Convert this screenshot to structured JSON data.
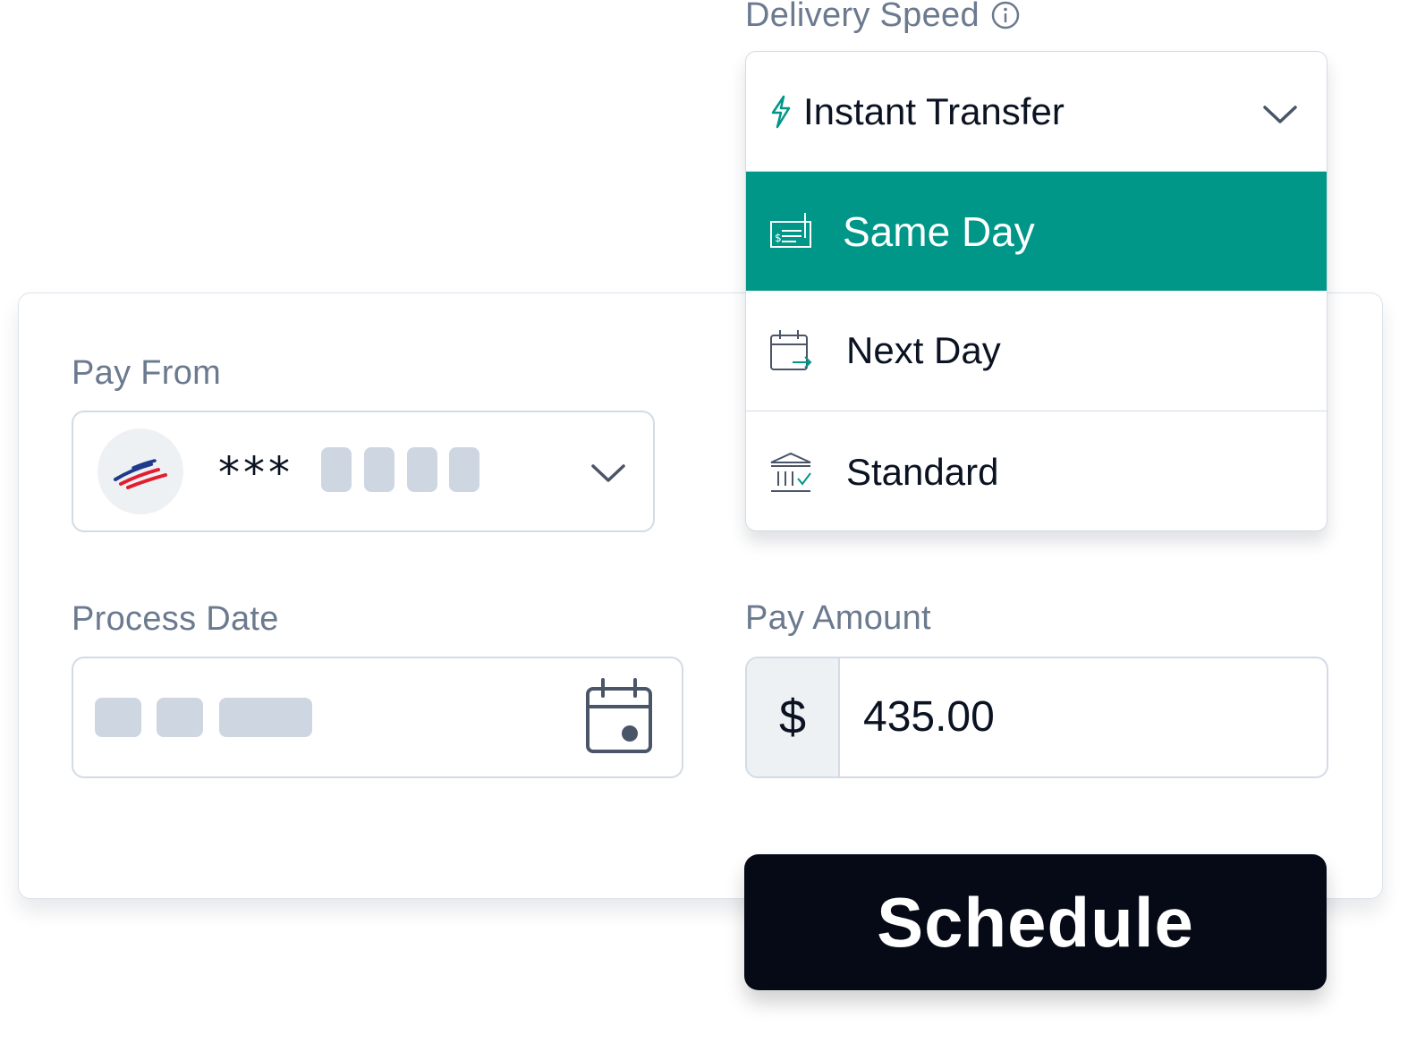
{
  "delivery_speed": {
    "label": "Delivery Speed",
    "selected": "Instant Transfer",
    "options": [
      {
        "label": "Same Day",
        "icon": "check-icon",
        "highlighted": true
      },
      {
        "label": "Next Day",
        "icon": "calendar-arrow-icon",
        "highlighted": false
      },
      {
        "label": "Standard",
        "icon": "bank-icon",
        "highlighted": false
      }
    ]
  },
  "pay_from": {
    "label": "Pay From",
    "account_mask": "***",
    "bank_logo": "bank-of-america-logo"
  },
  "process_date": {
    "label": "Process Date"
  },
  "pay_amount": {
    "label": "Pay Amount",
    "currency_symbol": "$",
    "value": "435.00"
  },
  "schedule_button": {
    "label": "Schedule"
  },
  "colors": {
    "accent": "#009688",
    "button": "#050a16",
    "label": "#6b7a8f",
    "mask": "#cdd6e1"
  }
}
